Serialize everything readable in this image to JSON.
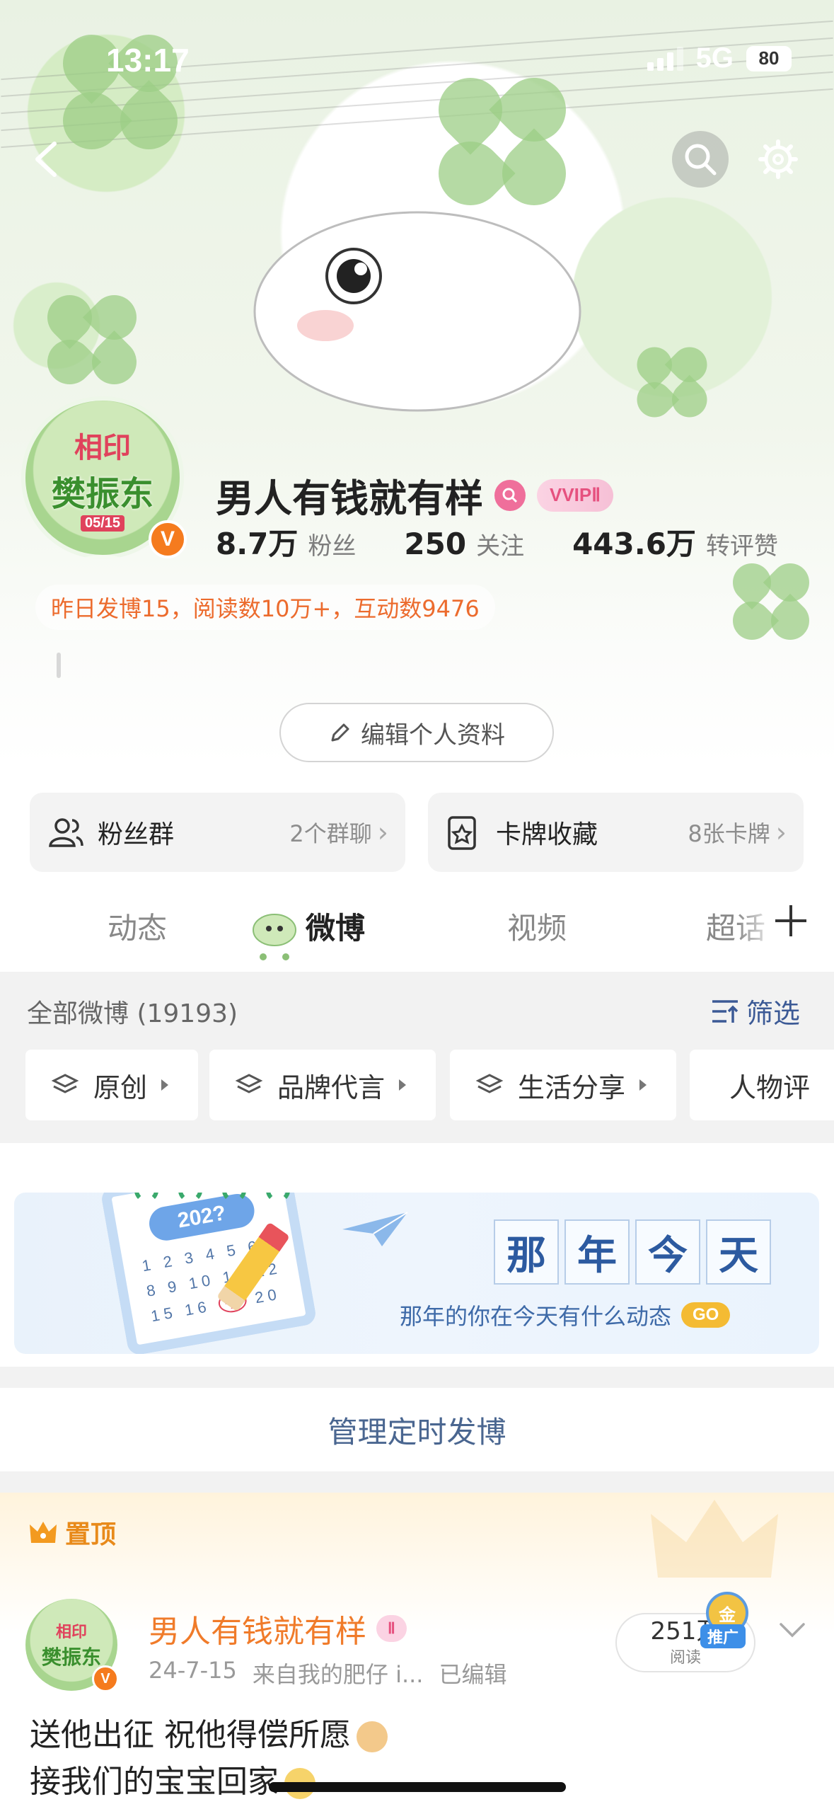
{
  "status_bar": {
    "time": "13:17",
    "network": "5G",
    "battery": "80"
  },
  "profile": {
    "name": "男人有钱就有样",
    "vip_badge": "VVIPⅡ",
    "avatar_text_top": "相印",
    "avatar_text_main": "樊振东",
    "avatar_date": "05/15",
    "verified_mark": "V",
    "stats": [
      {
        "value": "8.7万",
        "label": "粉丝"
      },
      {
        "value": "250",
        "label": "关注"
      },
      {
        "value": "443.6万",
        "label": "转评赞"
      }
    ],
    "yesterday_summary": "昨日发博15，阅读数10万+，互动数9476",
    "edit_button": "编辑个人资料"
  },
  "cards": [
    {
      "title": "粉丝群",
      "sub": "2个群聊",
      "icon": "fans-group-icon"
    },
    {
      "title": "卡牌收藏",
      "sub": "8张卡牌",
      "icon": "card-collection-icon"
    }
  ],
  "tabs": [
    {
      "label": "动态",
      "active": false
    },
    {
      "label": "微博",
      "active": true
    },
    {
      "label": "视频",
      "active": false
    },
    {
      "label": "超话",
      "active": false
    }
  ],
  "filter": {
    "all_label": "全部微博 (19193)",
    "screen_label": "筛选",
    "chips": [
      "原创",
      "品牌代言",
      "生活分享",
      "人物评"
    ]
  },
  "memory": {
    "title_chars": [
      "那",
      "年",
      "今",
      "天"
    ],
    "subtitle": "那年的你在今天有什么动态",
    "go": "GO",
    "calendar_year": "202?",
    "calendar_today": "今"
  },
  "manage_scheduled": "管理定时发博",
  "pinned_post": {
    "pin_label": "置顶",
    "author": "男人有钱就有样",
    "vip": "Ⅱ",
    "date": "24-7-15",
    "source": "来自我的肥仔 i...",
    "edited": "已编辑",
    "reads_value": "251万",
    "reads_label": "阅读",
    "promo_tag": "推广",
    "promo_medal": "金",
    "lines": [
      "送他出征 祝他得偿所愿",
      "接我们的宝宝回家"
    ]
  },
  "colors": {
    "accent_orange": "#f07b2a",
    "link_blue": "#3c5a96",
    "vip_pink": "#e6517f"
  }
}
